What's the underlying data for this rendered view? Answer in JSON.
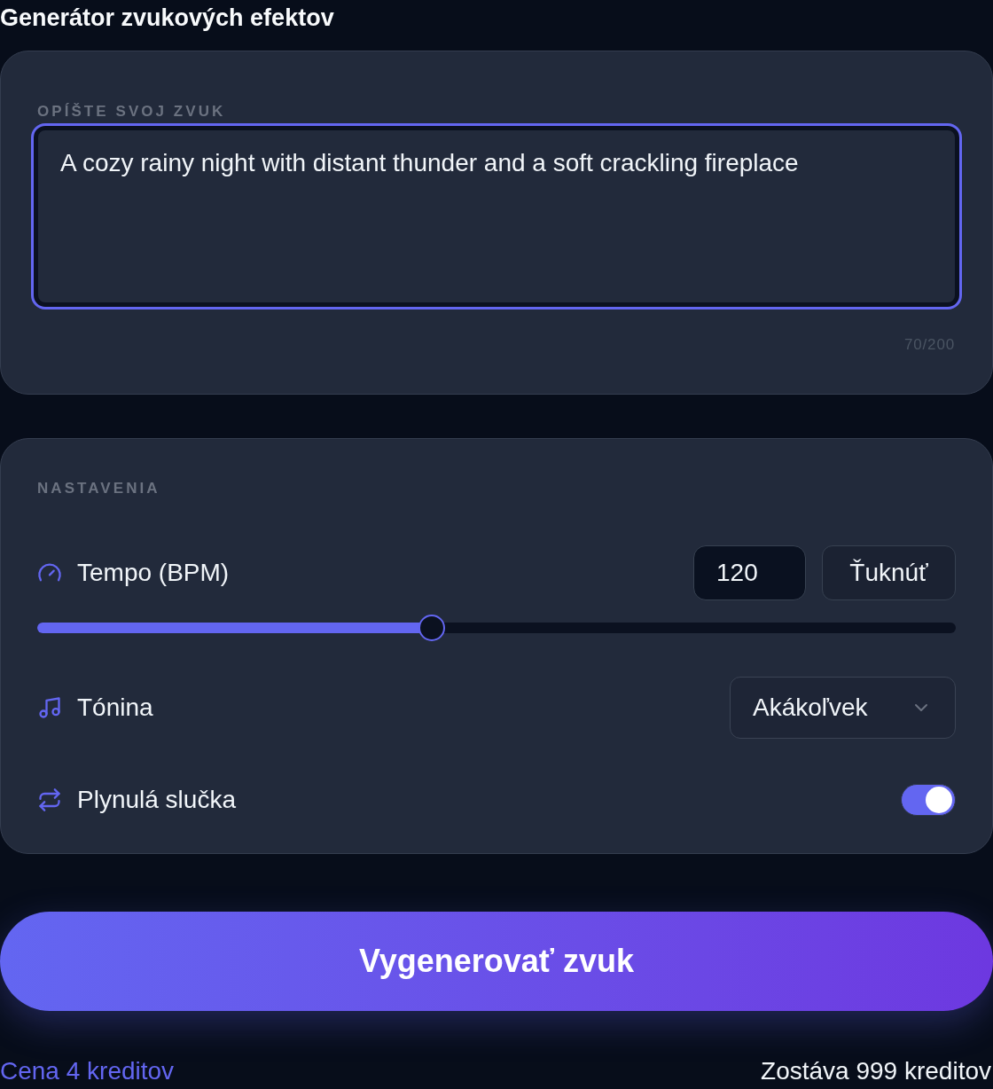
{
  "title": "Generátor zvukových efektov",
  "prompt": {
    "label": "OPÍŠTE SVOJ ZVUK",
    "value": "A cozy rainy night with distant thunder and a soft crackling fireplace",
    "focused": true,
    "counter": "70/200"
  },
  "settings": {
    "label": "NASTAVENIA",
    "rows": [
      {
        "kind": "slider",
        "label": "Tempo (BPM)",
        "value": "120",
        "button": "Ťuknúť",
        "level": 0.43
      },
      {
        "kind": "select",
        "label": "Tónina",
        "value": "Akákoľvek"
      },
      {
        "kind": "toggle",
        "label": "Plynulá slučka",
        "on": true
      }
    ]
  },
  "generate_button": "Vygenerovať zvuk",
  "footer": {
    "cost": "Cena 4 kreditov",
    "remaining": "Zostáva 999 kreditov"
  }
}
